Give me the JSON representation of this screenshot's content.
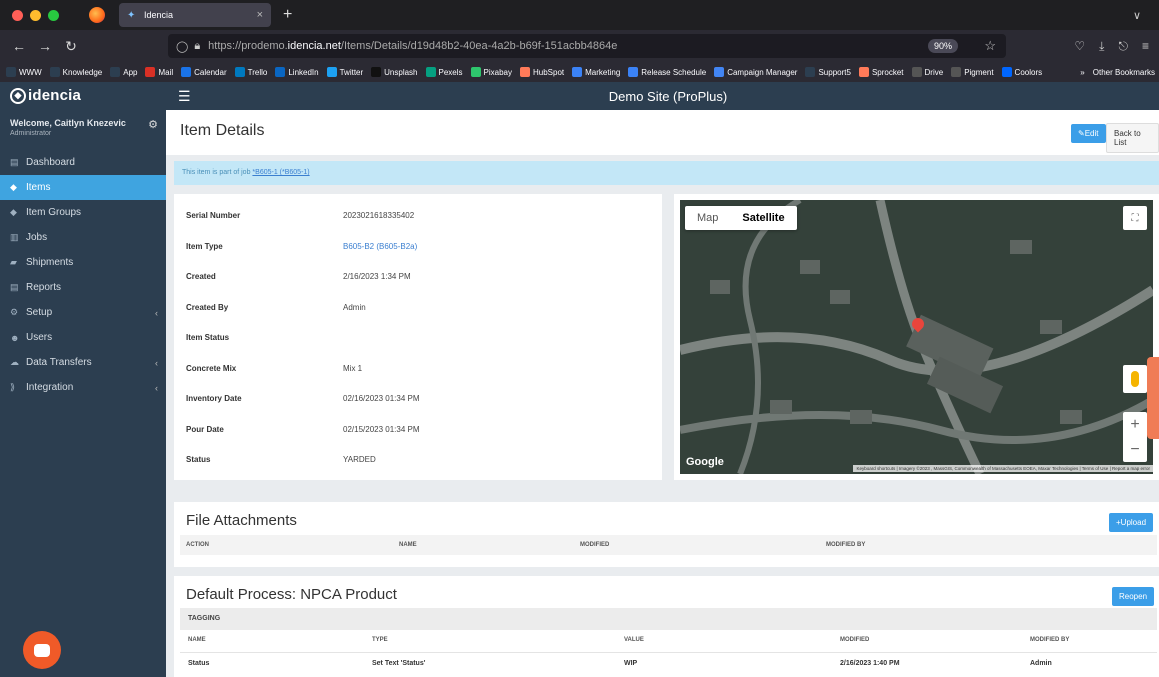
{
  "browser": {
    "tab_title": "Idencia",
    "tab_close": "×",
    "new_tab": "+",
    "url_prefix": "https://prodemo.",
    "url_host": "idencia.net",
    "url_path": "/Items/Details/d19d48b2-40ea-4a2b-b69f-151acbb4864e",
    "zoom": "90%",
    "bookmarks": [
      {
        "label": "WWW",
        "color": "#2c3e50"
      },
      {
        "label": "Knowledge",
        "color": "#2c3e50"
      },
      {
        "label": "App",
        "color": "#2c3e50"
      },
      {
        "label": "Mail",
        "color": "#d93025"
      },
      {
        "label": "Calendar",
        "color": "#1a73e8"
      },
      {
        "label": "Trello",
        "color": "#0079bf"
      },
      {
        "label": "LinkedIn",
        "color": "#0a66c2"
      },
      {
        "label": "Twitter",
        "color": "#1da1f2"
      },
      {
        "label": "Unsplash",
        "color": "#111111"
      },
      {
        "label": "Pexels",
        "color": "#05a081"
      },
      {
        "label": "Pixabay",
        "color": "#2ec66d"
      },
      {
        "label": "HubSpot",
        "color": "#ff7a59"
      },
      {
        "label": "Marketing",
        "color": "#3b82f6"
      },
      {
        "label": "Release Schedule",
        "color": "#3b82f6"
      },
      {
        "label": "Campaign Manager",
        "color": "#4285f4"
      },
      {
        "label": "Support5",
        "color": "#2c3e50"
      },
      {
        "label": "Sprocket",
        "color": "#ff7a59"
      },
      {
        "label": "Drive",
        "color": "#555555"
      },
      {
        "label": "Pigment",
        "color": "#555555"
      },
      {
        "label": "Coolors",
        "color": "#0066ff"
      }
    ],
    "more_bookmarks": "»",
    "other_bookmarks": "Other Bookmarks"
  },
  "app": {
    "logo": "idencia",
    "site_name": "Demo Site (ProPlus)"
  },
  "sidebar": {
    "welcome": "Welcome, Caitlyn Knezevic",
    "role": "Administrator",
    "items": [
      {
        "label": "Dashboard",
        "icon": "▤",
        "caret": ""
      },
      {
        "label": "Items",
        "icon": "◆",
        "caret": ""
      },
      {
        "label": "Item Groups",
        "icon": "◆",
        "caret": ""
      },
      {
        "label": "Jobs",
        "icon": "▥",
        "caret": ""
      },
      {
        "label": "Shipments",
        "icon": "▰",
        "caret": ""
      },
      {
        "label": "Reports",
        "icon": "▤",
        "caret": ""
      },
      {
        "label": "Setup",
        "icon": "⚙",
        "caret": "‹"
      },
      {
        "label": "Users",
        "icon": "☻",
        "caret": ""
      },
      {
        "label": "Data Transfers",
        "icon": "☁",
        "caret": "‹"
      },
      {
        "label": "Integration",
        "icon": "⟫",
        "caret": "‹"
      }
    ]
  },
  "page": {
    "title": "Item Details",
    "edit_label": "✎Edit",
    "back_label": "Back to List",
    "job_alert_text": "This item is part of job ",
    "job_alert_link": "*B605-1 (*B605-1)"
  },
  "details": [
    {
      "label": "Serial Number",
      "value": "2023021618335402",
      "link": false
    },
    {
      "label": "Item Type",
      "value": "B605-B2 (B605-B2a)",
      "link": true
    },
    {
      "label": "Created",
      "value": "2/16/2023 1:34 PM",
      "link": false
    },
    {
      "label": "Created By",
      "value": "Admin",
      "link": false
    },
    {
      "label": "Item Status",
      "value": "",
      "link": false
    },
    {
      "label": "Concrete Mix",
      "value": "Mix 1",
      "link": false
    },
    {
      "label": "Inventory Date",
      "value": "02/16/2023 01:34 PM",
      "link": false
    },
    {
      "label": "Pour Date",
      "value": "02/15/2023 01:34 PM",
      "link": false
    },
    {
      "label": "Status",
      "value": "YARDED",
      "link": false
    }
  ],
  "map": {
    "map_tab": "Map",
    "satellite_tab": "Satellite",
    "zoom_in": "+",
    "zoom_out": "−",
    "google": "Google",
    "attribution": "Keyboard shortcuts | Imagery ©2023 , MassGIS, Commonwealth of Massachusetts EOEA, Maxar Technologies | Terms of Use | Report a map error"
  },
  "files": {
    "title": "File Attachments",
    "upload_label": "+Upload",
    "columns": [
      "ACTION",
      "NAME",
      "MODIFIED",
      "MODIFIED BY"
    ]
  },
  "process": {
    "title": "Default Process: NPCA Product",
    "reopen_label": "Reopen",
    "group": "TAGGING",
    "columns": [
      "NAME",
      "TYPE",
      "VALUE",
      "MODIFIED",
      "MODIFIED BY"
    ],
    "rows": [
      {
        "name": "Status",
        "type": "Set Text 'Status'",
        "value": "WIP",
        "modified": "2/16/2023 1:40 PM",
        "modified_by": "Admin"
      }
    ]
  }
}
